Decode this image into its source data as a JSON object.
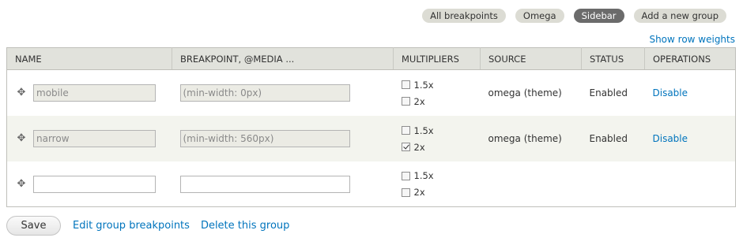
{
  "group_tabs": [
    {
      "label": "All breakpoints",
      "active": false
    },
    {
      "label": "Omega",
      "active": false
    },
    {
      "label": "Sidebar",
      "active": true
    },
    {
      "label": "Add a new group",
      "active": false
    }
  ],
  "show_row_weights": "Show row weights",
  "table": {
    "headers": {
      "name": "NAME",
      "breakpoint": "BREAKPOINT, @MEDIA ...",
      "multipliers": "MULTIPLIERS",
      "source": "SOURCE",
      "status": "STATUS",
      "operations": "OPERATIONS"
    },
    "rows": [
      {
        "name_value": "mobile",
        "media_value": "(min-width: 0px)",
        "mult": [
          {
            "label": "1.5x",
            "checked": false
          },
          {
            "label": "2x",
            "checked": false
          }
        ],
        "source": "omega (theme)",
        "status": "Enabled",
        "operation": "Disable"
      },
      {
        "name_value": "narrow",
        "media_value": "(min-width: 560px)",
        "mult": [
          {
            "label": "1.5x",
            "checked": false
          },
          {
            "label": "2x",
            "checked": true
          }
        ],
        "source": "omega (theme)",
        "status": "Enabled",
        "operation": "Disable"
      },
      {
        "name_value": "",
        "media_value": "",
        "mult": [
          {
            "label": "1.5x",
            "checked": false
          },
          {
            "label": "2x",
            "checked": false
          }
        ]
      }
    ]
  },
  "actions": {
    "save": "Save",
    "edit_group": "Edit group breakpoints",
    "delete_group": "Delete this group"
  }
}
